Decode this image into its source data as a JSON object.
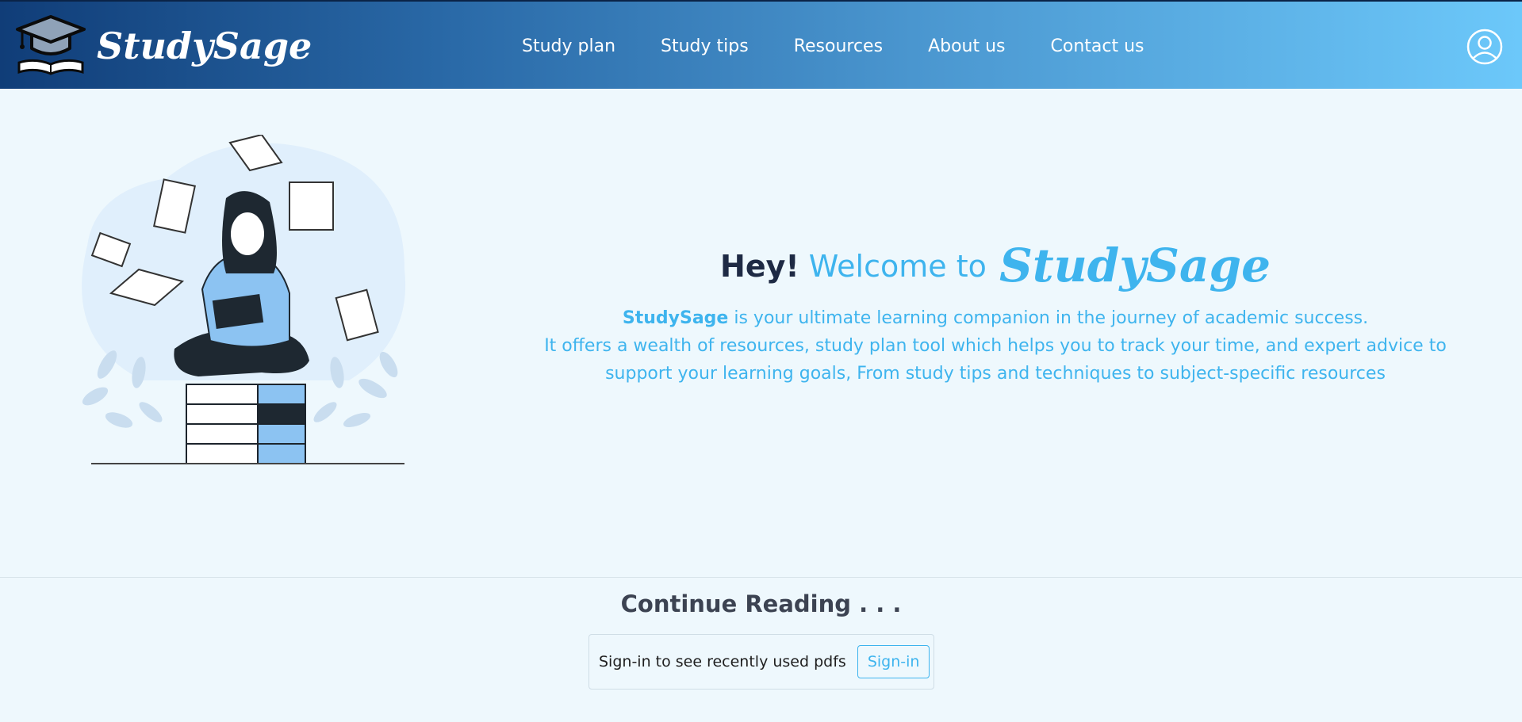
{
  "brand": {
    "name": "StudySage",
    "logo_icon": "graduation-cap-book-icon"
  },
  "nav": {
    "items": [
      "Study plan",
      "Study tips",
      "Resources",
      "About us",
      "Contact us"
    ]
  },
  "user": {
    "icon": "user-circle-icon"
  },
  "hero": {
    "greeting": "Hey!",
    "welcome": "Welcome to",
    "brand": "StudySage",
    "desc_brand": "StudySage",
    "desc_line1_rest": " is your ultimate learning companion in the journey of academic success.",
    "desc_line2": "It offers a wealth of resources, study plan tool which helps you to track your time, and expert advice to support your learning goals, From study tips and techniques to subject-specific resources",
    "illustration": "girl-reading-on-books-illustration"
  },
  "continue": {
    "title": "Continue Reading . . .",
    "prompt": "Sign-in to see recently used pdfs",
    "button": "Sign-in"
  },
  "colors": {
    "accent": "#3eb4ee",
    "dark": "#1e2a44",
    "nav_start": "#103d78",
    "nav_end": "#6cc8fa",
    "background": "#eef8fd"
  }
}
